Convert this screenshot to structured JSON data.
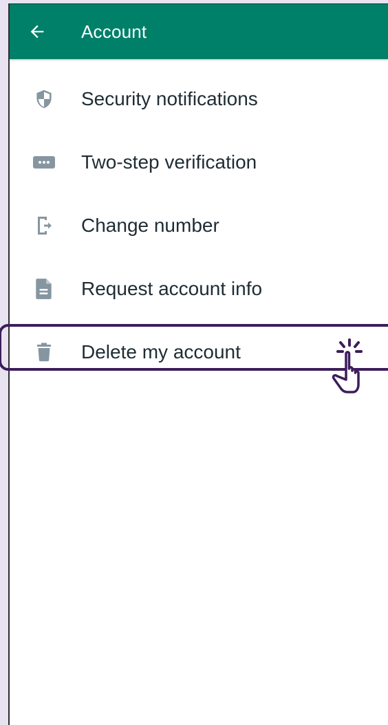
{
  "appbar": {
    "title": "Account",
    "background": "#008069",
    "back_icon": "arrow-left-icon"
  },
  "settings": {
    "items": [
      {
        "label": "Security notifications",
        "icon": "shield-icon"
      },
      {
        "label": "Two-step verification",
        "icon": "dots-password-icon"
      },
      {
        "label": "Change number",
        "icon": "change-number-icon"
      },
      {
        "label": "Request account info",
        "icon": "document-icon"
      },
      {
        "label": "Delete my account",
        "icon": "trash-icon",
        "highlighted": true
      }
    ]
  },
  "colors": {
    "icon": "#8696a0",
    "text": "#1f2c34",
    "highlight": "#3b1d5c"
  },
  "cursor_icon": "tap-hand-icon"
}
